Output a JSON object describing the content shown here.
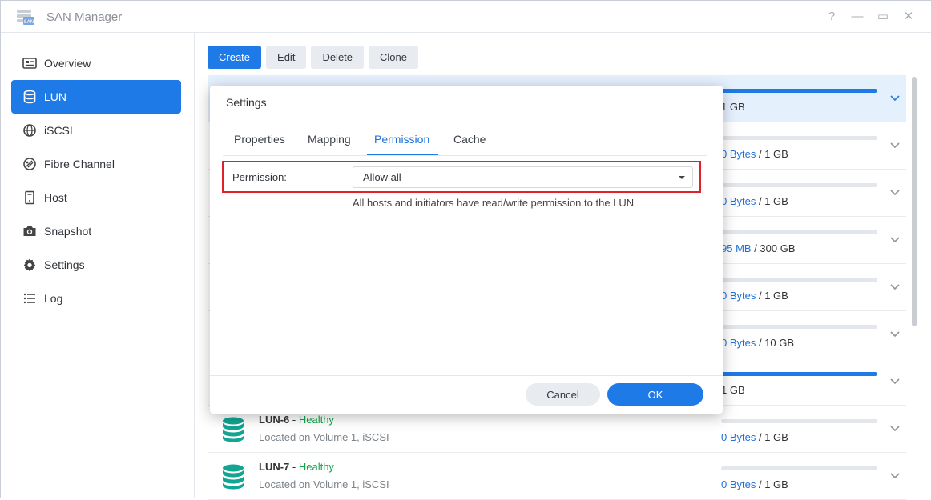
{
  "window": {
    "title": "SAN Manager",
    "controls": {
      "help": "?",
      "minimize": "—",
      "maximize": "▭",
      "close": "✕"
    }
  },
  "sidebar": {
    "items": [
      {
        "label": "Overview",
        "icon": "overview-icon",
        "active": false
      },
      {
        "label": "LUN",
        "icon": "database-icon",
        "active": true
      },
      {
        "label": "iSCSI",
        "icon": "globe-icon",
        "active": false
      },
      {
        "label": "Fibre Channel",
        "icon": "fibre-channel-icon",
        "active": false
      },
      {
        "label": "Host",
        "icon": "host-icon",
        "active": false
      },
      {
        "label": "Snapshot",
        "icon": "camera-icon",
        "active": false
      },
      {
        "label": "Settings",
        "icon": "gear-icon",
        "active": false
      },
      {
        "label": "Log",
        "icon": "list-icon",
        "active": false
      }
    ]
  },
  "toolbar": {
    "create": "Create",
    "edit": "Edit",
    "delete": "Delete",
    "clone": "Clone"
  },
  "lun_list": [
    {
      "name": "",
      "status": "",
      "location": "",
      "used": "",
      "total": "1 GB",
      "usage_fraction": 1.0,
      "selected": true
    },
    {
      "name": "",
      "status": "",
      "location": "",
      "used": "0 Bytes",
      "total": " / 1 GB",
      "usage_fraction": 0.0,
      "selected": false
    },
    {
      "name": "",
      "status": "",
      "location": "",
      "used": "0 Bytes",
      "total": " / 1 GB",
      "usage_fraction": 0.0,
      "selected": false
    },
    {
      "name": "",
      "status": "",
      "location": "",
      "used": "95 MB",
      "total": " / 300 GB",
      "usage_fraction": 0.0,
      "selected": false
    },
    {
      "name": "",
      "status": "",
      "location": "",
      "used": "0 Bytes",
      "total": " / 1 GB",
      "usage_fraction": 0.0,
      "selected": false
    },
    {
      "name": "",
      "status": "",
      "location": "",
      "used": "0 Bytes",
      "total": " / 10 GB",
      "usage_fraction": 0.0,
      "selected": false
    },
    {
      "name": "",
      "status": "",
      "location": "",
      "used": "",
      "total": "1 GB",
      "usage_fraction": 1.0,
      "selected": false
    },
    {
      "name": "LUN-6",
      "status": "Healthy",
      "location": "Located on Volume 1, iSCSI",
      "used": "0 Bytes",
      "total": " / 1 GB",
      "usage_fraction": 0.0,
      "selected": false
    },
    {
      "name": "LUN-7",
      "status": "Healthy",
      "location": "Located on Volume 1, iSCSI",
      "used": "0 Bytes",
      "total": " / 1 GB",
      "usage_fraction": 0.0,
      "selected": false
    }
  ],
  "dialog": {
    "title": "Settings",
    "tabs": [
      {
        "label": "Properties",
        "active": false
      },
      {
        "label": "Mapping",
        "active": false
      },
      {
        "label": "Permission",
        "active": true
      },
      {
        "label": "Cache",
        "active": false
      }
    ],
    "permission_label": "Permission:",
    "permission_value": "Allow all",
    "permission_help": "All hosts and initiators have read/write permission to the LUN",
    "cancel": "Cancel",
    "ok": "OK"
  },
  "colors": {
    "accent": "#1e7ae6",
    "healthy": "#16a34a",
    "highlight_border": "#e0202b",
    "selected_row": "#e5f0fd"
  }
}
